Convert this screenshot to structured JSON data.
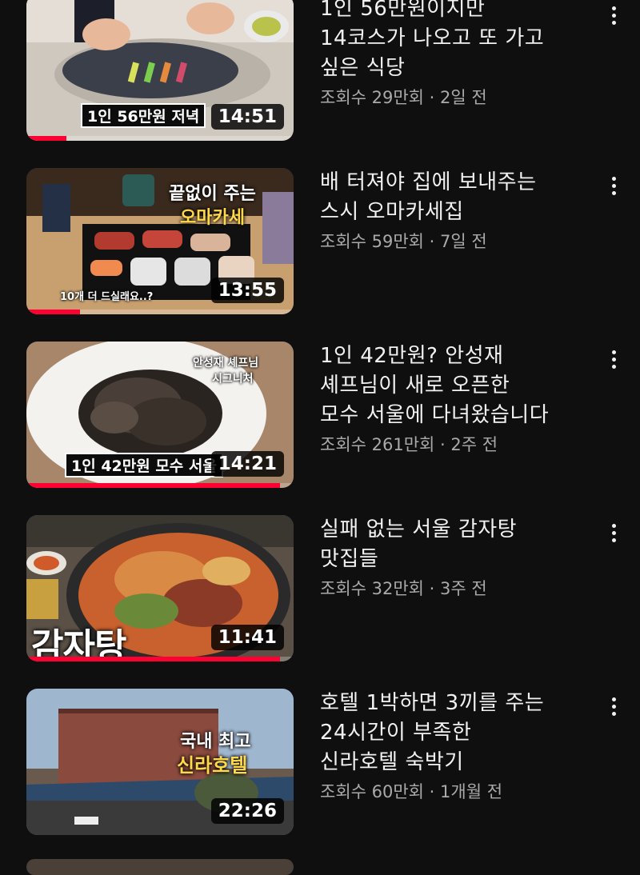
{
  "videos": [
    {
      "title_lines": [
        "1인 56만원이지만",
        "14코스가 나오고 또 가고",
        "싶은 식당"
      ],
      "views": "조회수 29만회",
      "age": "2일 전",
      "duration": "14:51",
      "watched_fraction": 0.15,
      "thumb_caption": "1인 56만원 저녁"
    },
    {
      "title_lines": [
        "배 터져야 집에 보내주는",
        "스시 오마카세집"
      ],
      "views": "조회수 59만회",
      "age": "7일 전",
      "duration": "13:55",
      "watched_fraction": 0.2,
      "thumb_caption": "끝없이 주는",
      "thumb_caption2": "오마카세",
      "thumb_caption3": "10개 더 드실래요..?"
    },
    {
      "title_lines": [
        "1인 42만원? 안성재",
        "셰프님이 새로 오픈한",
        "모수 서울에 다녀왔습니다"
      ],
      "views": "조회수 261만회",
      "age": "2주 전",
      "duration": "14:21",
      "watched_fraction": 0.95,
      "thumb_caption": "1인 42만원 모수 서울",
      "thumb_caption2": "안성재 셰프님",
      "thumb_caption3": "시그니처"
    },
    {
      "title_lines": [
        "실패 없는 서울 감자탕",
        "맛집들"
      ],
      "views": "조회수 32만회",
      "age": "3주 전",
      "duration": "11:41",
      "watched_fraction": 0.95,
      "thumb_caption": "감자탕"
    },
    {
      "title_lines": [
        "호텔 1박하면 3끼를 주는",
        "24시간이 부족한",
        "신라호텔 숙박기"
      ],
      "views": "조회수 60만회",
      "age": "1개월 전",
      "duration": "22:26",
      "watched_fraction": 0.0,
      "thumb_caption": "국내 최고",
      "thumb_caption2": "신라호텔"
    }
  ],
  "separator": " · ",
  "menu_icon": "more-vert-icon",
  "colors": {
    "background": "#0f0f0f",
    "progress": "#ff0033",
    "meta_text": "#aaaaaa"
  }
}
